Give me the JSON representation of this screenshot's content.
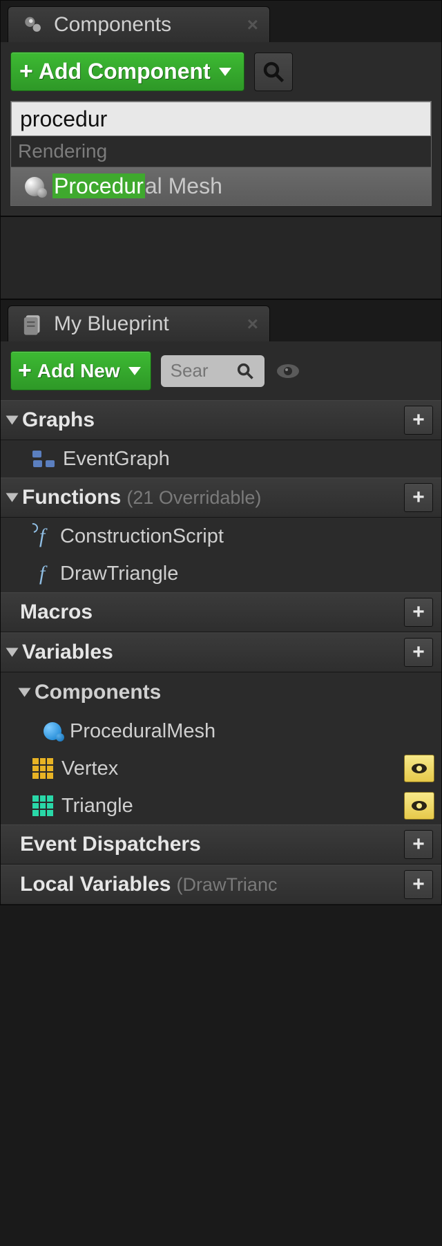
{
  "components_panel": {
    "tab_title": "Components",
    "add_button": "Add Component",
    "search_value": "procedur",
    "category": "Rendering",
    "result_match": "Procedur",
    "result_rest": "al Mesh"
  },
  "blueprint_panel": {
    "tab_title": "My Blueprint",
    "add_button": "Add New",
    "search_placeholder": "Sear",
    "sections": {
      "graphs_label": "Graphs",
      "eventgraph": "EventGraph",
      "functions_label": "Functions",
      "functions_ann": "(21 Overridable)",
      "construction": "ConstructionScript",
      "drawtriangle": "DrawTriangle",
      "macros_label": "Macros",
      "variables_label": "Variables",
      "components_label": "Components",
      "proc_mesh": "ProceduralMesh",
      "vertex": "Vertex",
      "triangle": "Triangle",
      "dispatchers_label": "Event Dispatchers",
      "localvars_label": "Local Variables",
      "localvars_ann": "(DrawTrianc"
    }
  }
}
